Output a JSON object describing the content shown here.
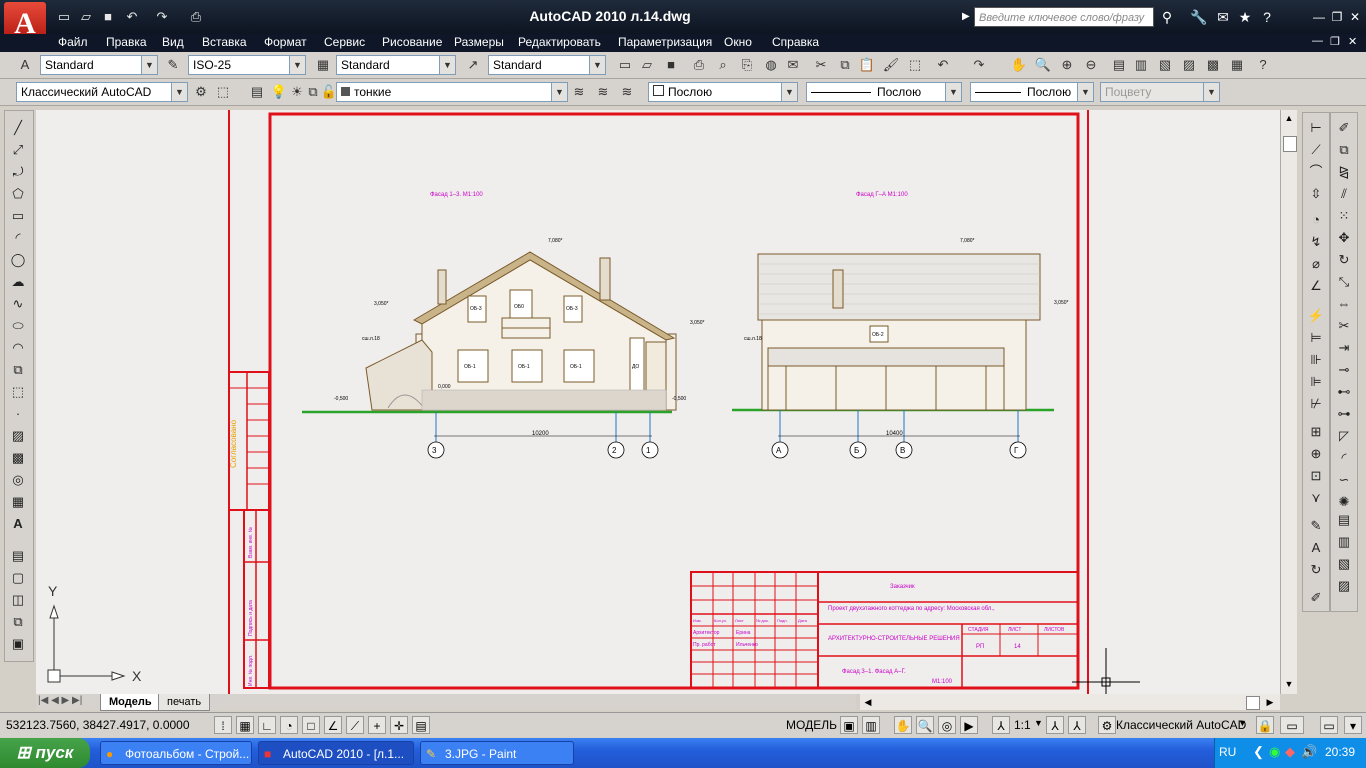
{
  "window": {
    "app_logo": "A",
    "title": "AutoCAD 2010    л.14.dwg",
    "search_placeholder": "Введите ключевое слово/фразу"
  },
  "menu": [
    "Файл",
    "Правка",
    "Вид",
    "Вставка",
    "Формат",
    "Сервис",
    "Рисование",
    "Размеры",
    "Редактировать",
    "Параметризация",
    "Окно",
    "Справка"
  ],
  "styles_toolbar": {
    "text_style": "Standard",
    "dim_style": "ISO-25",
    "table_style": "Standard",
    "mleader_style": "Standard"
  },
  "layers_toolbar": {
    "workspace": "Классический AutoCAD",
    "layer": "тонкие",
    "color": "Послою",
    "linetype": "Послою",
    "lineweight": "Послою",
    "plotstyle": "Поцвету"
  },
  "drawing": {
    "facade_left_title": "Фасад 1–3.   М1:100",
    "facade_right_title": "Фасад Г–А   М1:100",
    "levels": [
      "7,080*",
      "3,050*",
      "3,050*",
      "0,000",
      "-0,500",
      "-0,500",
      "7,080*",
      "3,050*"
    ],
    "window_labels": [
      "ОБ-3",
      "ОБ0",
      "ОБ-3",
      "ОБ-1",
      "ОБ-1",
      "ОБ-1",
      "ДО",
      "ОБ-2"
    ],
    "notes": [
      "сш.л.18",
      "сш.л.18"
    ],
    "dims": [
      "10200",
      "10400"
    ],
    "axes_left": [
      "3",
      "2",
      "1"
    ],
    "axes_right": [
      "А",
      "Б",
      "В",
      "Г"
    ],
    "side_stamp": "Согласовано",
    "side_stamp_cells": [
      "Взам. инв. №",
      "Подпись и дата",
      "Инв. № подл."
    ],
    "title_block": {
      "customer": "Заказчик",
      "project": "Проект двухэтажного коттеджа по адресу: Московская обл.,",
      "section": "АРХИТЕКТУРНО-СТРОИТЕЛЬНЫЕ РЕШЕНИЯ",
      "sheet_title": "Фасад 3–1. Фасад А–Г.",
      "scale": "М1:100",
      "stage_hdr": "СТАДИЯ",
      "sheet_hdr": "ЛИСТ",
      "sheets_hdr": "ЛИСТОВ",
      "stage": "РП",
      "sheet": "14",
      "cols": [
        "Изм.",
        "Кол.уч.",
        "Лист",
        "№ док.",
        "Подп.",
        "Дата"
      ],
      "roles": [
        "Архитектор",
        "Пр. работ"
      ],
      "names": [
        "Ерина",
        "Ильченко"
      ]
    },
    "ucs_x": "X",
    "ucs_y": "Y"
  },
  "layout_tabs": [
    "Модель",
    "печать"
  ],
  "status": {
    "coords": "532123.7560, 38427.4917, 0.0000",
    "model": "МОДЕЛЬ",
    "scale": "1:1",
    "workspace": "Классический AutoCAD"
  },
  "taskbar": {
    "start": "пуск",
    "tasks": [
      "Фотоальбом - Строй...",
      "AutoCAD 2010 - [л.1...",
      "3.JPG - Paint"
    ],
    "lang": "RU",
    "time": "20:39"
  },
  "colors": {
    "frame_red": "#e0101a",
    "annotation_magenta": "#c800c8",
    "wall_brown": "#7a5a2a",
    "ground_green": "#2aa32a",
    "axis_blue": "#1e78c8"
  }
}
